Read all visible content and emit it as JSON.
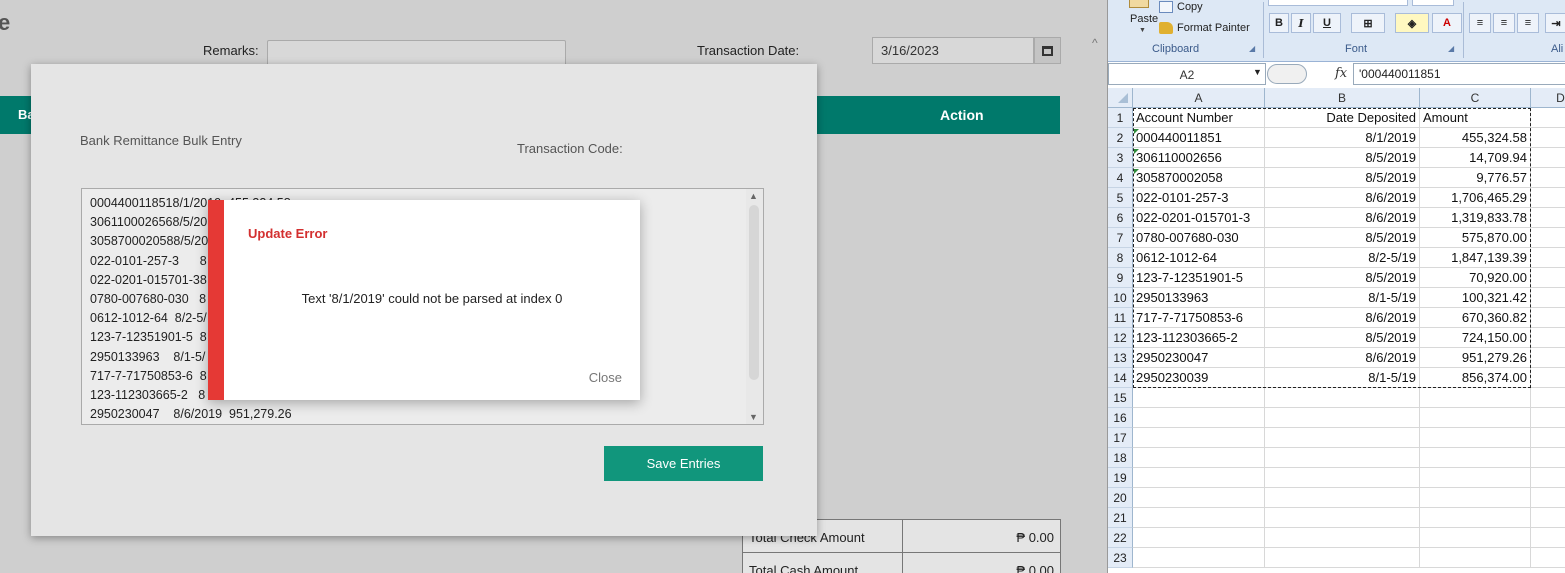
{
  "app": {
    "page_title_fragment": "e",
    "remarks_label": "Remarks:",
    "transaction_date_label": "Transaction Date:",
    "transaction_date_value": "3/16/2023",
    "table_header_left": "Ba",
    "table_header_action": "Action",
    "totals": [
      {
        "label": "Total Check Amount",
        "value": "₱ 0.00"
      },
      {
        "label": "Total Cash Amount",
        "value": "₱ 0.00"
      }
    ]
  },
  "bulk_modal": {
    "title": "Bank Remittance Bulk Entry",
    "transaction_code_label": "Transaction Code:",
    "lines": [
      "0004400118518/1/2019  455,324.58",
      "3061100026568/5/20",
      "3058700020588/5/20",
      "022-0101-257-3      8",
      "022-0201-015701-38",
      "0780-007680-030   8",
      "0612-1012-64  8/2-5/",
      "123-7-12351901-5  8",
      "2950133963    8/1-5/",
      "717-7-71750853-6  8",
      "123-112303665-2   8",
      "2950230047    8/6/2019  951,279.26"
    ],
    "save_button": "Save Entries"
  },
  "error_dialog": {
    "title": "Update Error",
    "message": "Text '8/1/2019' could not be parsed at index 0",
    "close_label": "Close"
  },
  "excel": {
    "clipboard": {
      "paste": "Paste",
      "copy": "Copy",
      "format_painter": "Format Painter",
      "group": "Clipboard"
    },
    "font_group": "Font",
    "alignment_group_fragment": "Ali",
    "bold": "B",
    "italic": "I",
    "underline": "U",
    "font_color_letter": "A",
    "name_box": "A2",
    "fx_symbol": "fx",
    "formula_value": "'000440011851",
    "columns": [
      "A",
      "B",
      "C",
      "D"
    ],
    "rows": [
      {
        "n": "1",
        "a": "Account Number",
        "b": "Date Deposited",
        "c": "Amount"
      },
      {
        "n": "2",
        "a": "000440011851",
        "b": "8/1/2019",
        "c": "455,324.58"
      },
      {
        "n": "3",
        "a": "306110002656",
        "b": "8/5/2019",
        "c": "14,709.94"
      },
      {
        "n": "4",
        "a": "305870002058",
        "b": "8/5/2019",
        "c": "9,776.57"
      },
      {
        "n": "5",
        "a": "022-0101-257-3",
        "b": "8/6/2019",
        "c": "1,706,465.29"
      },
      {
        "n": "6",
        "a": "022-0201-015701-3",
        "b": "8/6/2019",
        "c": "1,319,833.78"
      },
      {
        "n": "7",
        "a": "0780-007680-030",
        "b": "8/5/2019",
        "c": "575,870.00"
      },
      {
        "n": "8",
        "a": "0612-1012-64",
        "b": "8/2-5/19",
        "c": "1,847,139.39"
      },
      {
        "n": "9",
        "a": "123-7-12351901-5",
        "b": "8/5/2019",
        "c": "70,920.00"
      },
      {
        "n": "10",
        "a": "2950133963",
        "b": "8/1-5/19",
        "c": "100,321.42"
      },
      {
        "n": "11",
        "a": "717-7-71750853-6",
        "b": "8/6/2019",
        "c": "670,360.82"
      },
      {
        "n": "12",
        "a": "123-112303665-2",
        "b": "8/5/2019",
        "c": "724,150.00"
      },
      {
        "n": "13",
        "a": "2950230047",
        "b": "8/6/2019",
        "c": "951,279.26"
      },
      {
        "n": "14",
        "a": "2950230039",
        "b": "8/1-5/19",
        "c": "856,374.00"
      },
      {
        "n": "15",
        "a": "",
        "b": "",
        "c": ""
      },
      {
        "n": "16",
        "a": "",
        "b": "",
        "c": ""
      },
      {
        "n": "17",
        "a": "",
        "b": "",
        "c": ""
      },
      {
        "n": "18",
        "a": "",
        "b": "",
        "c": ""
      },
      {
        "n": "19",
        "a": "",
        "b": "",
        "c": ""
      },
      {
        "n": "20",
        "a": "",
        "b": "",
        "c": ""
      },
      {
        "n": "21",
        "a": "",
        "b": "",
        "c": ""
      },
      {
        "n": "22",
        "a": "",
        "b": "",
        "c": ""
      },
      {
        "n": "23",
        "a": "",
        "b": "",
        "c": ""
      }
    ]
  },
  "colors": {
    "teal_header": "#00796b",
    "save_button": "#11967c",
    "error_accent": "#e53935",
    "error_title": "#d32f2f"
  }
}
